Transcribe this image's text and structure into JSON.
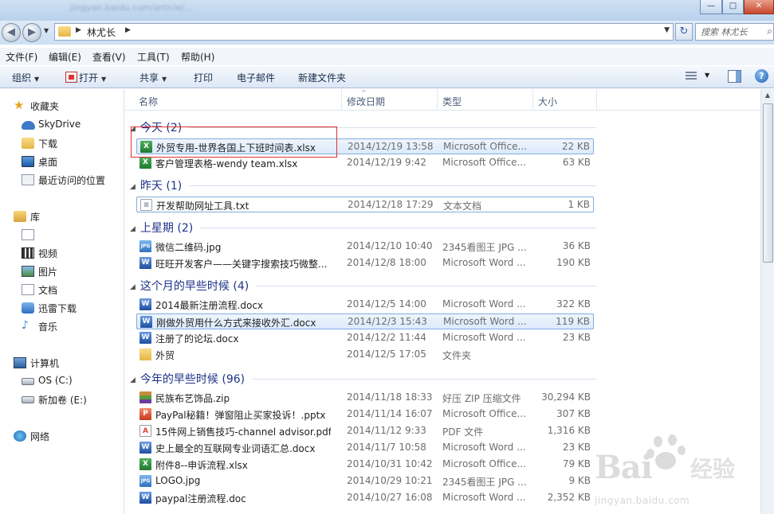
{
  "window": {
    "title_blur": "jingyan.baidu.com/article/..."
  },
  "address": {
    "crumb": "林尤长",
    "search_placeholder": "搜索 林尤长"
  },
  "menu": [
    "文件(F)",
    "编辑(E)",
    "查看(V)",
    "工具(T)",
    "帮助(H)"
  ],
  "toolbar": {
    "organize": "组织",
    "open": "打开",
    "share": "共享",
    "print": "打印",
    "email": "电子邮件",
    "newfolder": "新建文件夹"
  },
  "nav": {
    "favorites": "收藏夹",
    "skydrive": "SkyDrive",
    "downloads": "下载",
    "desktop": "桌面",
    "recent": "最近访问的位置",
    "libraries": "库",
    "videos": "视频",
    "pictures": "图片",
    "documents": "文档",
    "thunder": "迅雷下载",
    "music": "音乐",
    "computer": "计算机",
    "drive_c": "OS (C:)",
    "drive_e": "新加卷 (E:)",
    "network": "网络"
  },
  "columns": {
    "name": "名称",
    "modified": "修改日期",
    "type": "类型",
    "size": "大小"
  },
  "groups": [
    {
      "label": "今天 (2)",
      "files": [
        {
          "name": "外贸专用-世界各国上下班时间表.xlsx",
          "date": "2014/12/19 13:58",
          "type": "Microsoft Office...",
          "size": "22 KB",
          "icon": "xlsx-icon"
        },
        {
          "name": "客户管理表格-wendy team.xlsx",
          "date": "2014/12/19 9:42",
          "type": "Microsoft Office...",
          "size": "63 KB",
          "icon": "xlsx-icon"
        }
      ]
    },
    {
      "label": "昨天 (1)",
      "files": [
        {
          "name": "开发帮助网址工具.txt",
          "date": "2014/12/18 17:29",
          "type": "文本文档",
          "size": "1 KB",
          "icon": "txt-icon"
        }
      ]
    },
    {
      "label": "上星期 (2)",
      "files": [
        {
          "name": "微信二维码.jpg",
          "date": "2014/12/10 10:40",
          "type": "2345看图王 JPG ...",
          "size": "36 KB",
          "icon": "jpg-icon"
        },
        {
          "name": "旺旺开发客户——关键字搜索技巧微整...",
          "date": "2014/12/8 18:00",
          "type": "Microsoft Word ...",
          "size": "190 KB",
          "icon": "docx-icon"
        }
      ]
    },
    {
      "label": "这个月的早些时候 (4)",
      "files": [
        {
          "name": "2014最新注册流程.docx",
          "date": "2014/12/5 14:00",
          "type": "Microsoft Word ...",
          "size": "322 KB",
          "icon": "docx-icon"
        },
        {
          "name": "刚做外贸用什么方式来接收外汇.docx",
          "date": "2014/12/3 15:43",
          "type": "Microsoft Word ...",
          "size": "119 KB",
          "icon": "docx-icon"
        },
        {
          "name": "注册了的论坛.docx",
          "date": "2014/12/2 11:44",
          "type": "Microsoft Word ...",
          "size": "23 KB",
          "icon": "docx-icon"
        },
        {
          "name": "外贸",
          "date": "2014/12/5 17:05",
          "type": "文件夹",
          "size": "",
          "icon": "folder-icon"
        }
      ]
    },
    {
      "label": "今年的早些时候 (96)",
      "files": [
        {
          "name": "民族布艺饰品.zip",
          "date": "2014/11/18 18:33",
          "type": "好压 ZIP 压缩文件",
          "size": "30,294 KB",
          "icon": "zip-icon"
        },
        {
          "name": "PayPal秘籍！弹窗阻止买家投诉！.pptx",
          "date": "2014/11/14 16:07",
          "type": "Microsoft Office...",
          "size": "307 KB",
          "icon": "pptx-icon"
        },
        {
          "name": "15件网上销售技巧-channel advisor.pdf",
          "date": "2014/11/12 9:33",
          "type": "PDF 文件",
          "size": "1,316 KB",
          "icon": "pdf-icon"
        },
        {
          "name": "史上最全的互联网专业词语汇总.docx",
          "date": "2014/11/7 10:58",
          "type": "Microsoft Word ...",
          "size": "23 KB",
          "icon": "docx-icon"
        },
        {
          "name": "附件8--申诉流程.xlsx",
          "date": "2014/10/31 10:42",
          "type": "Microsoft Office...",
          "size": "79 KB",
          "icon": "xlsx-icon"
        },
        {
          "name": "LOGO.jpg",
          "date": "2014/10/29 10:21",
          "type": "2345看图王 JPG ...",
          "size": "9 KB",
          "icon": "jpg-icon"
        },
        {
          "name": "paypal注册流程.doc",
          "date": "2014/10/27 16:08",
          "type": "Microsoft Word ...",
          "size": "2,352 KB",
          "icon": "docx-icon"
        }
      ]
    }
  ],
  "watermark": {
    "brand": "Bai",
    "brand2": "经验",
    "url": "jingyan.baidu.com"
  }
}
